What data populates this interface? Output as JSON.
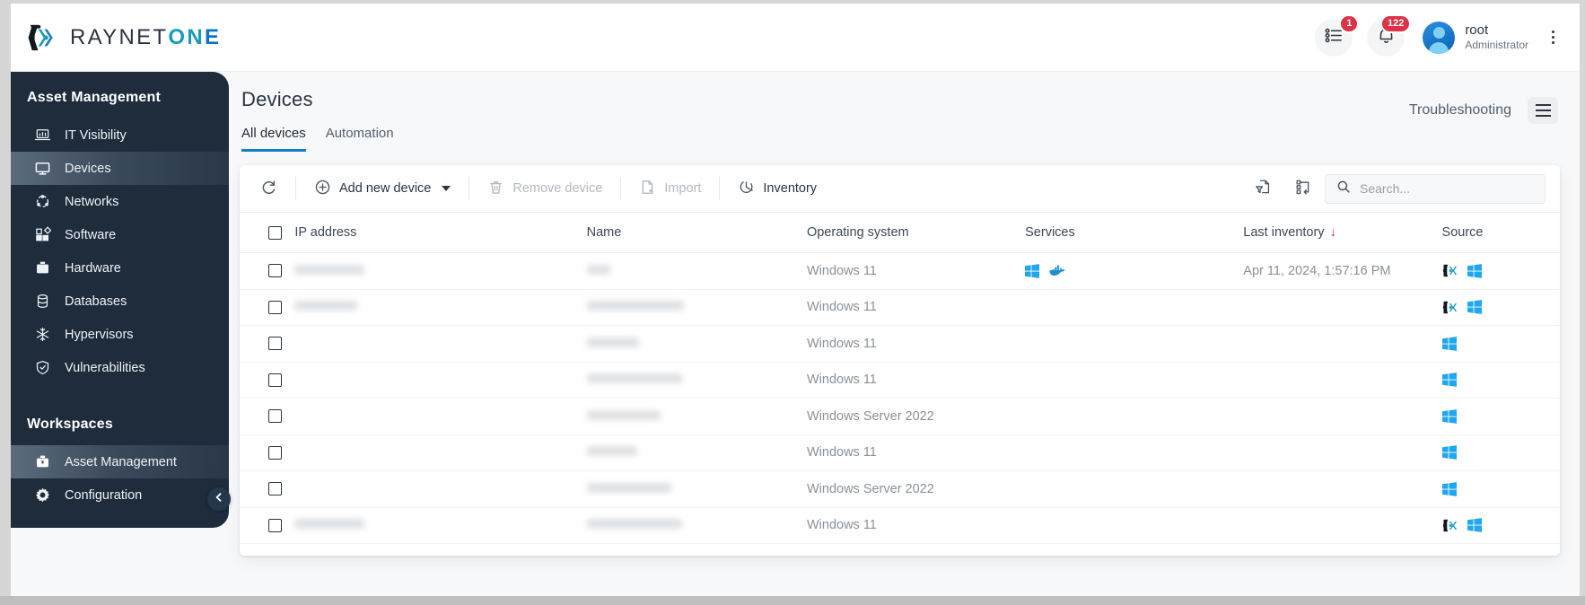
{
  "brand": {
    "name_part1": "RAYNET",
    "name_part2": "ON",
    "name_part3": "E",
    "logo_icon": "raynet-logo-icon",
    "colors": {
      "dark": "#2b3440",
      "teal": "#1a9bb8",
      "blue": "#0c76c4"
    }
  },
  "header": {
    "tasks_icon": "task-list-icon",
    "tasks_badge": "1",
    "notifications_icon": "bell-icon",
    "notifications_badge": "122",
    "user_name": "root",
    "user_role": "Administrator",
    "avatar_icon": "user-avatar-icon",
    "overflow_icon": "kebab-menu-icon"
  },
  "sidebar": {
    "section_title": "Asset Management",
    "items": [
      {
        "label": "IT Visibility",
        "icon": "laptop-chart-icon",
        "active": false
      },
      {
        "label": "Devices",
        "icon": "monitor-icon",
        "active": true
      },
      {
        "label": "Networks",
        "icon": "network-nodes-icon",
        "active": false
      },
      {
        "label": "Software",
        "icon": "blocks-icon",
        "active": false
      },
      {
        "label": "Hardware",
        "icon": "toolbox-icon",
        "active": false
      },
      {
        "label": "Databases",
        "icon": "database-icon",
        "active": false
      },
      {
        "label": "Hypervisors",
        "icon": "snowflake-icon",
        "active": false
      },
      {
        "label": "Vulnerabilities",
        "icon": "shield-check-icon",
        "active": false
      }
    ],
    "workspaces_title": "Workspaces",
    "workspaces": [
      {
        "label": "Asset Management",
        "icon": "briefcase-icon",
        "active": true
      },
      {
        "label": "Configuration",
        "icon": "gear-icon",
        "active": false
      }
    ],
    "collapse_icon": "chevron-left-icon"
  },
  "main": {
    "title": "Devices",
    "tabs": [
      {
        "label": "All devices",
        "active": true
      },
      {
        "label": "Automation",
        "active": false
      }
    ],
    "troubleshooting_label": "Troubleshooting",
    "menu_icon": "hamburger-icon"
  },
  "toolbar": {
    "refresh_icon": "refresh-icon",
    "add_label": "Add new device",
    "add_icon": "plus-circle-icon",
    "add_caret_icon": "chevron-down-icon",
    "remove_label": "Remove device",
    "remove_icon": "trash-icon",
    "import_label": "Import",
    "import_icon": "file-import-icon",
    "inventory_label": "Inventory",
    "inventory_icon": "inventory-scan-icon",
    "filter_export_icon": "filter-document-icon",
    "columns_icon": "column-layout-icon",
    "search_placeholder": "Search...",
    "search_value": "",
    "search_icon": "search-icon"
  },
  "table": {
    "columns": [
      {
        "key": "check",
        "label": ""
      },
      {
        "key": "ip",
        "label": "IP address"
      },
      {
        "key": "name",
        "label": "Name"
      },
      {
        "key": "os",
        "label": "Operating system"
      },
      {
        "key": "services",
        "label": "Services"
      },
      {
        "key": "inventory",
        "label": "Last inventory"
      },
      {
        "key": "source",
        "label": "Source"
      }
    ],
    "sorted_column": "Last inventory",
    "sort_direction": "desc",
    "sort_icon": "arrow-down-icon",
    "select_all_checked": false,
    "rows": [
      {
        "ip": "",
        "ip_w": 78,
        "name": "",
        "name_w": 26,
        "os": "Windows 11",
        "services": [
          "windows-icon",
          "docker-icon"
        ],
        "inventory": "Apr 11, 2024, 1:57:16 PM",
        "source": [
          "raynet-icon",
          "windows-icon"
        ]
      },
      {
        "ip": "",
        "ip_w": 70,
        "name": "",
        "name_w": 108,
        "os": "Windows 11",
        "services": [],
        "inventory": "",
        "source": [
          "raynet-icon",
          "windows-icon"
        ]
      },
      {
        "ip": "",
        "ip_w": 0,
        "name": "",
        "name_w": 58,
        "os": "Windows 11",
        "services": [],
        "inventory": "",
        "source": [
          "windows-icon"
        ]
      },
      {
        "ip": "",
        "ip_w": 0,
        "name": "",
        "name_w": 106,
        "os": "Windows 11",
        "services": [],
        "inventory": "",
        "source": [
          "windows-icon"
        ]
      },
      {
        "ip": "",
        "ip_w": 0,
        "name": "",
        "name_w": 82,
        "os": "Windows Server 2022",
        "services": [],
        "inventory": "",
        "source": [
          "windows-icon"
        ]
      },
      {
        "ip": "",
        "ip_w": 0,
        "name": "",
        "name_w": 56,
        "os": "Windows 11",
        "services": [],
        "inventory": "",
        "source": [
          "windows-icon"
        ]
      },
      {
        "ip": "",
        "ip_w": 0,
        "name": "",
        "name_w": 94,
        "os": "Windows Server 2022",
        "services": [],
        "inventory": "",
        "source": [
          "windows-icon"
        ]
      },
      {
        "ip": "",
        "ip_w": 78,
        "name": "",
        "name_w": 106,
        "os": "Windows 11",
        "services": [],
        "inventory": "",
        "source": [
          "raynet-icon",
          "windows-icon"
        ]
      }
    ]
  }
}
